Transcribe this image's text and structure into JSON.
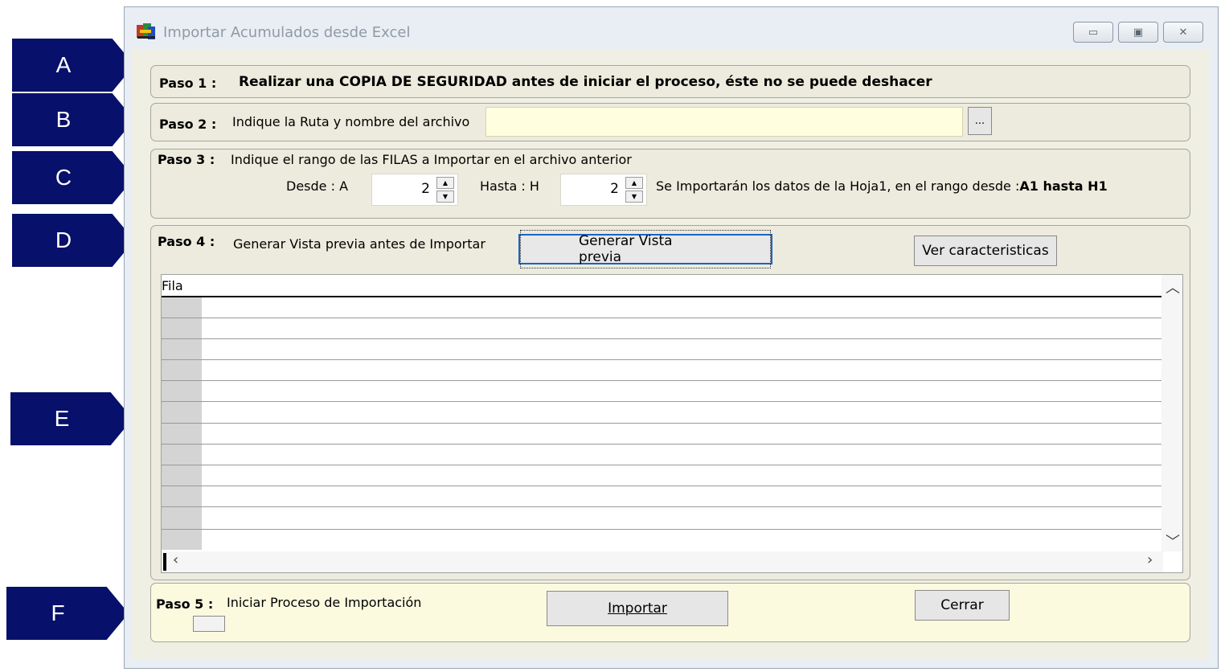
{
  "callouts": [
    "A",
    "B",
    "C",
    "D",
    "E",
    "F"
  ],
  "window": {
    "title": "Importar Acumulados desde Excel",
    "controls": {
      "minimize": "▭",
      "maximize": "▣",
      "close": "✕"
    }
  },
  "step1": {
    "label": "Paso 1 :",
    "text": "Realizar una COPIA DE SEGURIDAD antes de iniciar el proceso, éste no se puede deshacer"
  },
  "step2": {
    "label": "Paso 2 :",
    "text": "Indique la Ruta y nombre del archivo",
    "file_path": "",
    "browse_label": "..."
  },
  "step3": {
    "label": "Paso 3 :",
    "text": "Indique el rango de las FILAS a Importar en el archivo anterior",
    "desde_label": "Desde  :   A",
    "desde_value": "2",
    "hasta_label": "Hasta  :   H",
    "hasta_value": "2",
    "summary_text": "Se Importarán los datos de la Hoja1,  en el rango desde :",
    "summary_range": "A1 hasta H1"
  },
  "step4": {
    "label": "Paso 4 :",
    "text": "Generar Vista previa antes de Importar",
    "preview_button": "Generar Vista previa",
    "features_button": "Ver caracteristicas",
    "grid": {
      "columns": [
        "Fila"
      ],
      "rows": []
    }
  },
  "step5": {
    "label": "Paso 5 :",
    "text": "Iniciar Proceso de Importación",
    "import_button": "Importar",
    "close_button": "Cerrar"
  },
  "colors": {
    "callout": "#07106a",
    "panel": "#ecebdd",
    "input_yellow": "#ffffe0",
    "focus_border": "#1a63c6"
  }
}
